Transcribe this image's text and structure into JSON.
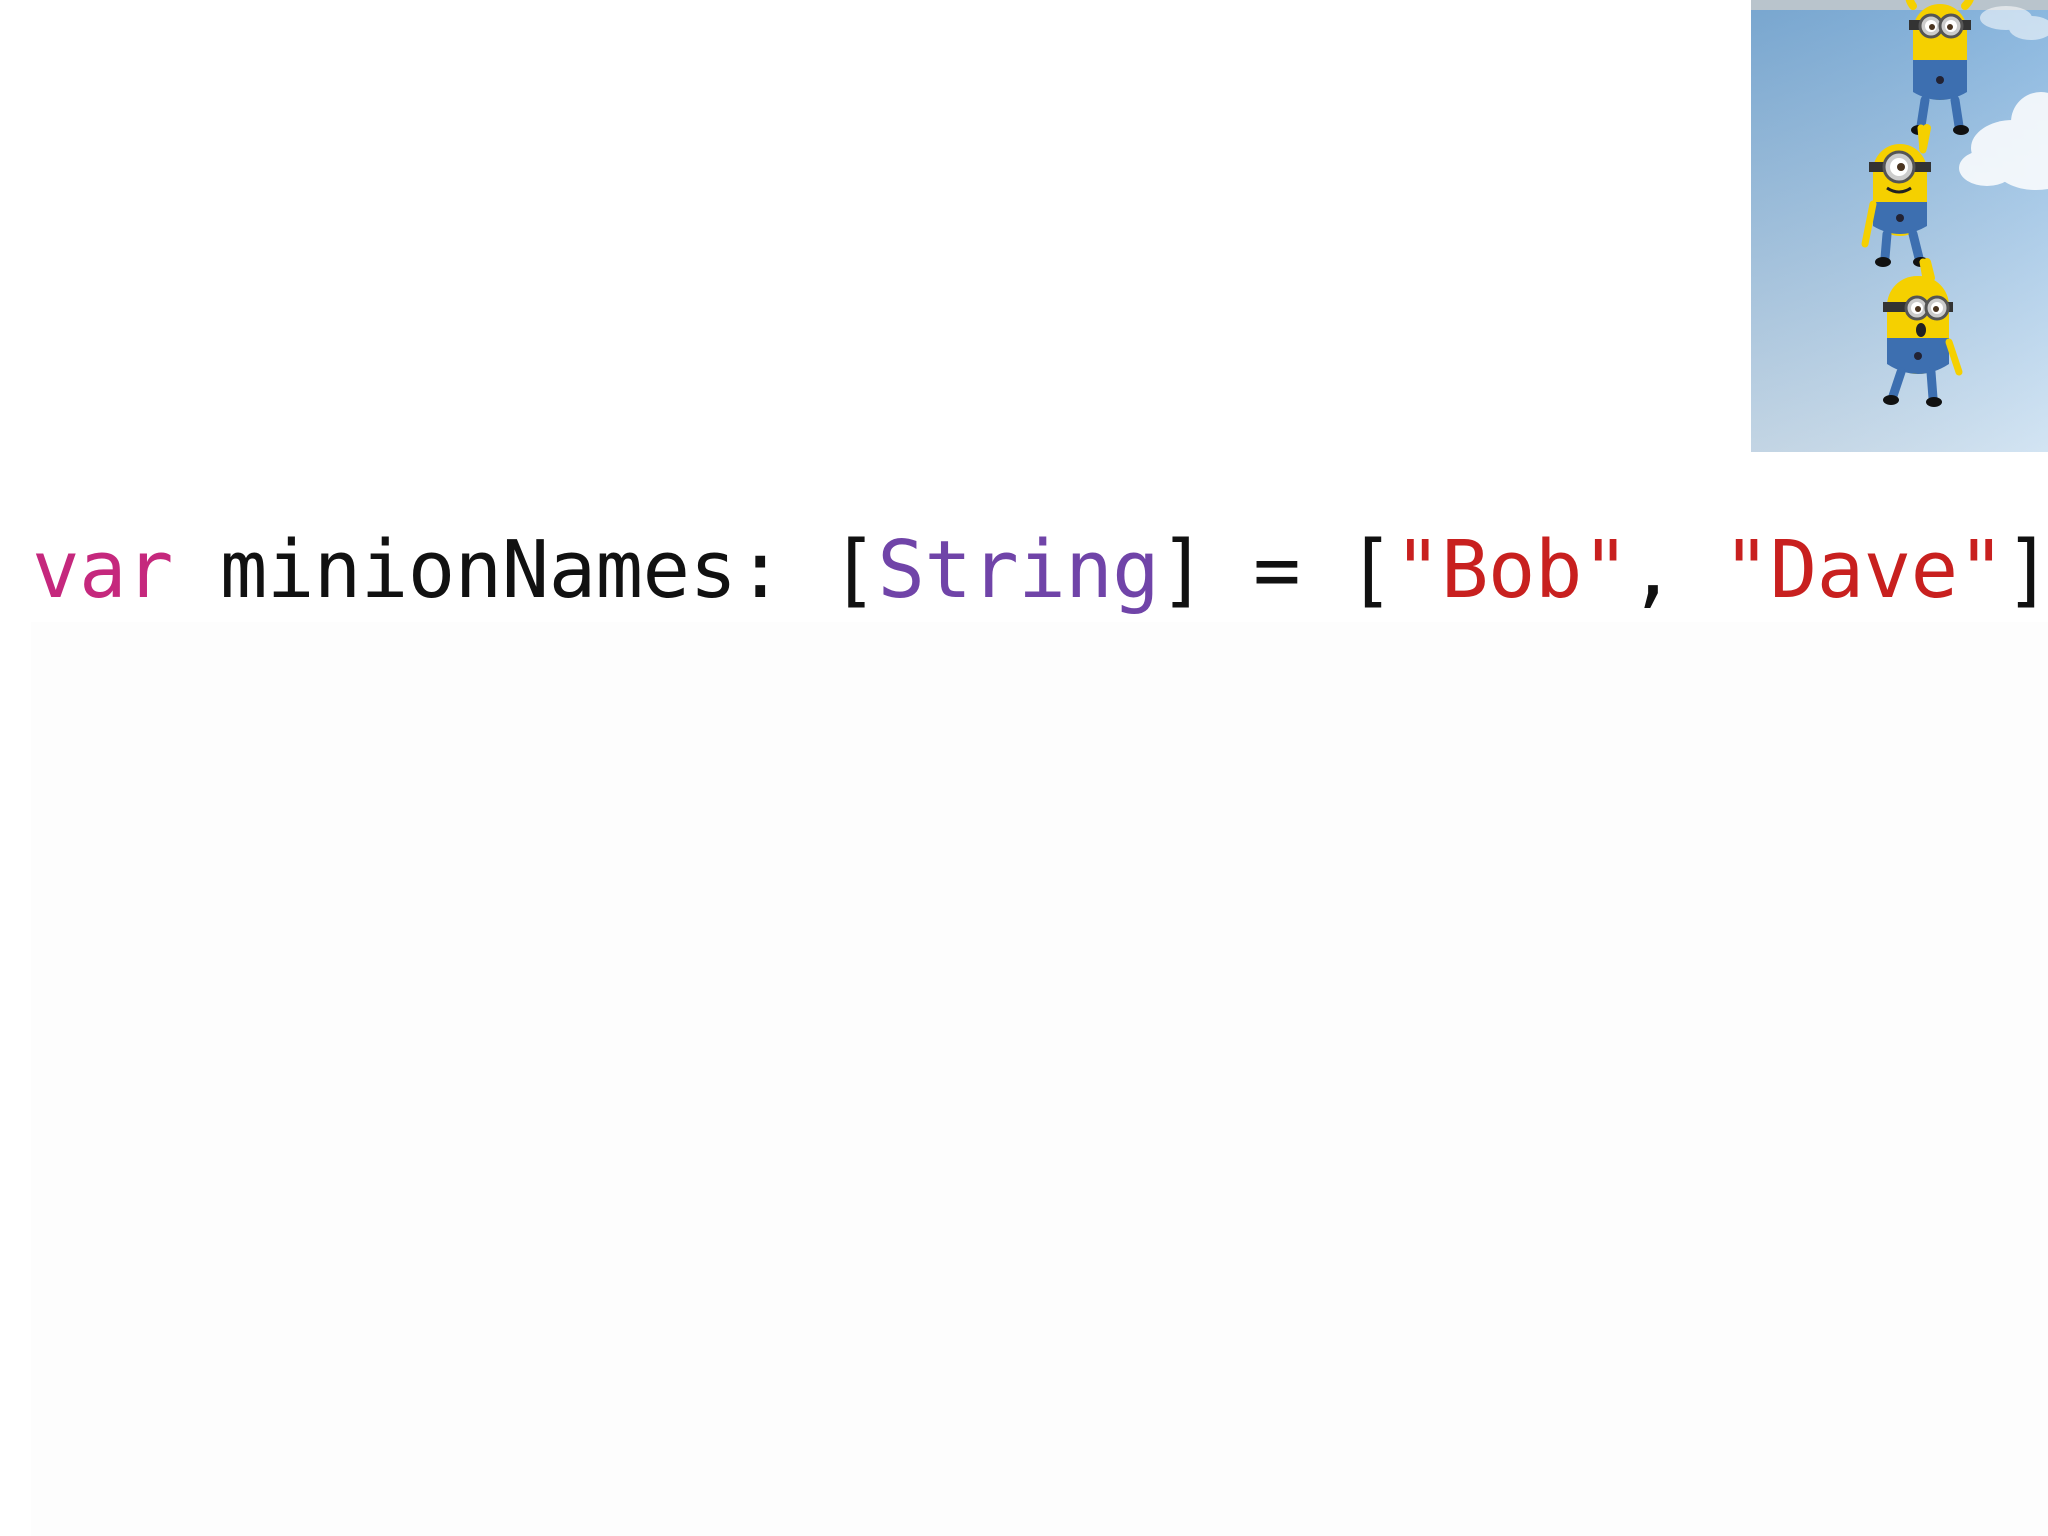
{
  "code": {
    "keyword": "var",
    "sp1": " ",
    "identifier": "minionNames",
    "colon": ":",
    "sp2": " ",
    "open_type_bracket": "[",
    "type_name": "String",
    "close_type_bracket": "]",
    "sp3": " ",
    "equals": "=",
    "sp4": " ",
    "open_array_bracket": "[",
    "string_1": "\"Bob\"",
    "comma": ",",
    "sp5": " ",
    "string_2": "\"Dave\"",
    "close_array_bracket": "]"
  },
  "colors": {
    "keyword": "#c5287d",
    "type": "#7044a8",
    "string": "#c8201f",
    "plain": "#111111"
  },
  "thumbnail": {
    "subject": "three minions hanging in a chain against a blue sky",
    "icon": "minions-image"
  }
}
